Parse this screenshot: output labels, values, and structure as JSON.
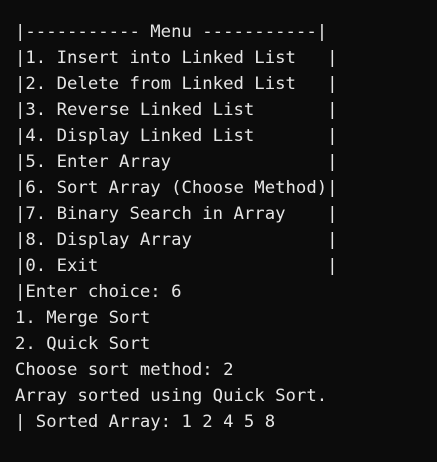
{
  "terminal": {
    "lines": [
      "|----------- Menu -----------|",
      "|1. Insert into Linked List   |",
      "|2. Delete from Linked List   |",
      "|3. Reverse Linked List       |",
      "|4. Display Linked List       |",
      "|5. Enter Array               |",
      "|6. Sort Array (Choose Method)|",
      "|7. Binary Search in Array    |",
      "|8. Display Array             |",
      "|0. Exit                      |",
      "|Enter choice: 6",
      "1. Merge Sort",
      "2. Quick Sort",
      "Choose sort method: 2",
      "Array sorted using Quick Sort.",
      "| Sorted Array: 1 2 4 5 8"
    ]
  }
}
